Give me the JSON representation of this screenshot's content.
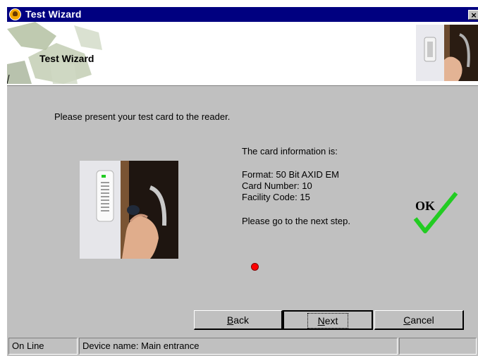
{
  "window": {
    "title": "Test Wizard",
    "close_label": "×"
  },
  "header": {
    "title": "Test Wizard"
  },
  "main": {
    "instruction": "Please present your test card to the reader.",
    "info_heading": "The card information is:",
    "format": "Format: 50 Bit AXID EM",
    "card_number": "Card Number: 10",
    "facility_code": "Facility Code: 15",
    "next_step": "Please go to the next step.",
    "ok_text": "OK"
  },
  "buttons": {
    "back_mnemonic": "B",
    "back_rest": "ack",
    "next_mnemonic": "N",
    "next_rest": "ext",
    "cancel_mnemonic": "C",
    "cancel_rest": "ancel"
  },
  "statusbar": {
    "connection": "On Line",
    "device": "Device name: Main entrance",
    "extra": ""
  },
  "colors": {
    "titlebar": "#000080",
    "status_dot": "#ff0000",
    "ok_check": "#22cc22"
  }
}
